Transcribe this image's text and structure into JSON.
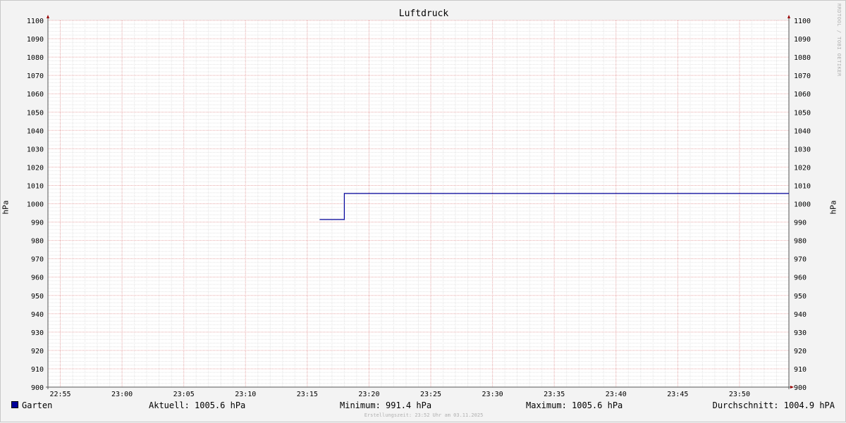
{
  "chart_data": {
    "type": "line",
    "title": "Luftdruck",
    "ylabel_left": "hPa",
    "ylabel_right": "hPa",
    "ylim": [
      900,
      1100
    ],
    "ytick_labels": [
      "900",
      "910",
      "920",
      "930",
      "940",
      "950",
      "960",
      "970",
      "980",
      "990",
      "1000",
      "1010",
      "1020",
      "1030",
      "1040",
      "1050",
      "1060",
      "1070",
      "1080",
      "1090",
      "1100"
    ],
    "xlim": [
      "22:54",
      "23:54"
    ],
    "xtick_labels": [
      "22:55",
      "23:00",
      "23:05",
      "23:10",
      "23:15",
      "23:20",
      "23:25",
      "23:30",
      "23:35",
      "23:40",
      "23:45",
      "23:50"
    ],
    "grid": true,
    "series": [
      {
        "name": "Garten",
        "color": "#000099",
        "points": [
          [
            "23:16",
            991.4
          ],
          [
            "23:18",
            991.4
          ],
          [
            "23:18",
            1005.6
          ],
          [
            "23:54",
            1005.6
          ]
        ]
      }
    ]
  },
  "legend": {
    "series_name": "Garten",
    "current": "Aktuell: 1005.6 hPa",
    "minimum": "Minimum: 991.4 hPa",
    "maximum": "Maximum: 1005.6 hPa",
    "average": "Durchschnitt: 1004.9 hPA"
  },
  "watermark": "RRDTOOL / TOBI OETIKER",
  "footer": "Erstellungszeit: 23:52 Uhr am 03.11.2025"
}
